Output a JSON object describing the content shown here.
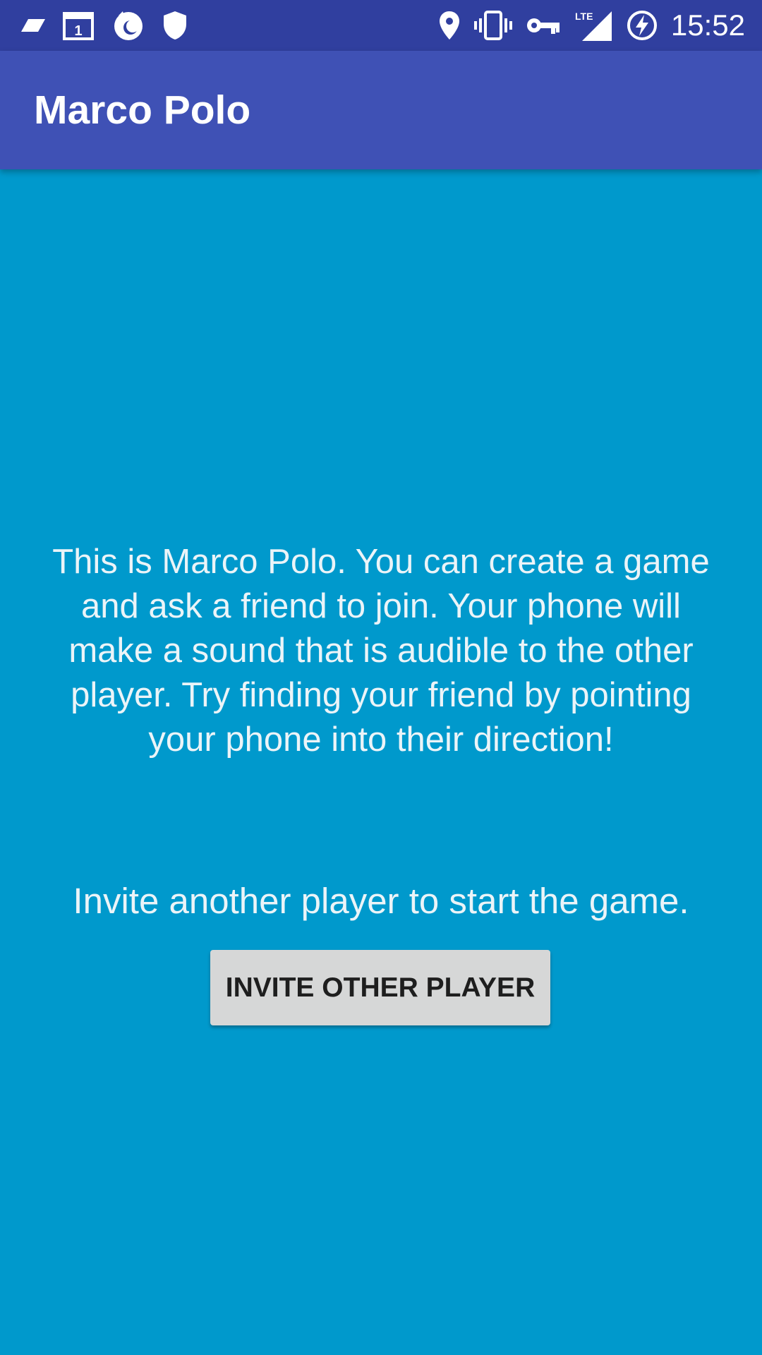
{
  "status_bar": {
    "time": "15:52",
    "network_type": "LTE",
    "calendar_day": "1",
    "left_icons": [
      "notification-icon",
      "calendar-icon",
      "firefox-icon",
      "shield-icon"
    ],
    "right_icons": [
      "location-icon",
      "vibrate-icon",
      "vpn-key-icon",
      "lte-signal-icon",
      "battery-charging-icon"
    ]
  },
  "app_bar": {
    "title": "Marco Polo",
    "color": "#3f51b5",
    "status_color": "#303f9f"
  },
  "main": {
    "background_color": "#0099cc",
    "description": "This is Marco Polo. You can create a game and ask a friend to join. Your phone will make a sound that is audible to the other player. Try finding your friend by pointing your phone into their direction!",
    "invite_prompt": "Invite another player to start the game.",
    "invite_button_label": "INVITE OTHER PLAYER"
  }
}
